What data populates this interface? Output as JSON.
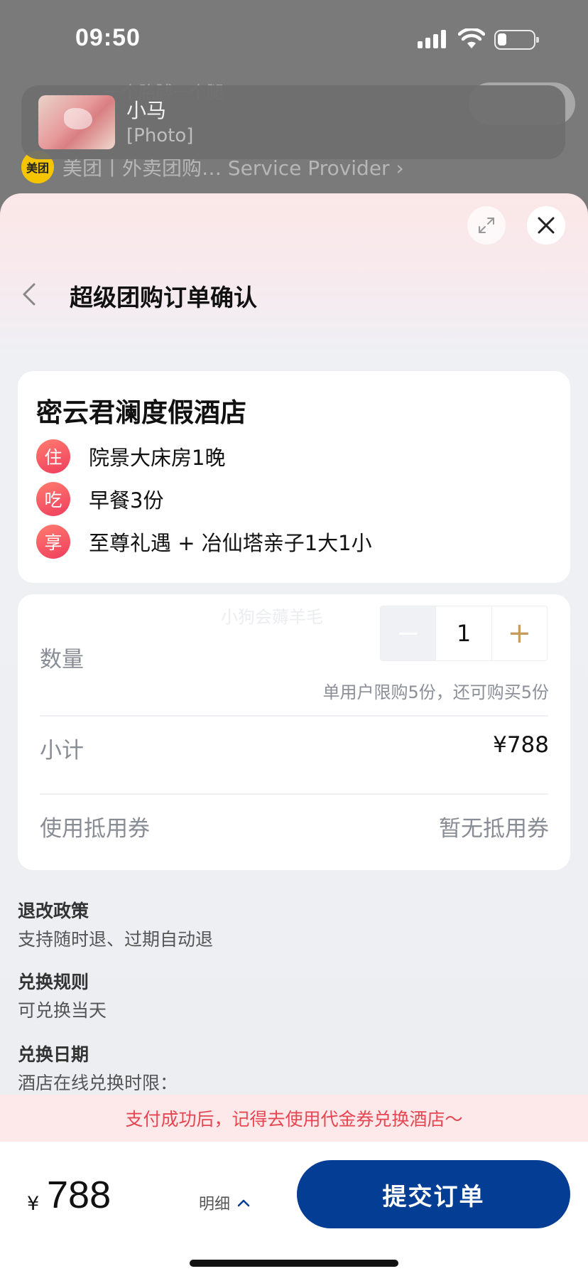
{
  "status_bar": {
    "time": "09:50"
  },
  "background": {
    "header_text": "一个胳膊一个腿",
    "provider_logo": "美团",
    "provider_text": "美团丨外卖团购…   Service Provider  ›"
  },
  "notification": {
    "sender": "小马",
    "message": "[Photo]"
  },
  "sheet": {
    "title": "超级团购订单确认",
    "hotel": {
      "name": "密云君澜度假酒店",
      "features": [
        {
          "badge": "住",
          "text": "院景大床房1晚"
        },
        {
          "badge": "吃",
          "text": "早餐3份"
        },
        {
          "badge": "享",
          "text": "至尊礼遇 + 冶仙塔亲子1大1小"
        }
      ]
    },
    "order": {
      "watermark": "小狗会薅羊毛",
      "quantity_label": "数量",
      "quantity_value": "1",
      "minus_symbol": "−",
      "plus_symbol": "+",
      "limit_text": "单用户限购5份，还可购买5份",
      "subtotal_label": "小计",
      "subtotal_value": "¥788",
      "coupon_label": "使用抵用券",
      "coupon_value": "暂无抵用券"
    },
    "policies": [
      {
        "title": "退改政策",
        "text": "支持随时退、过期自动退"
      },
      {
        "title": "兑换规则",
        "text": "可兑换当天"
      },
      {
        "title": "兑换日期",
        "text": "酒店在线兑换时限："
      }
    ],
    "tip": "支付成功后，记得去使用代金券兑换酒店～",
    "footer": {
      "currency": "¥",
      "price": "788",
      "detail_label": "明细",
      "submit_label": "提交订单"
    }
  },
  "colors": {
    "accent": "#043d94",
    "badge": "#ef3d5e",
    "tip": "#e64552",
    "plus": "#c79a62"
  }
}
